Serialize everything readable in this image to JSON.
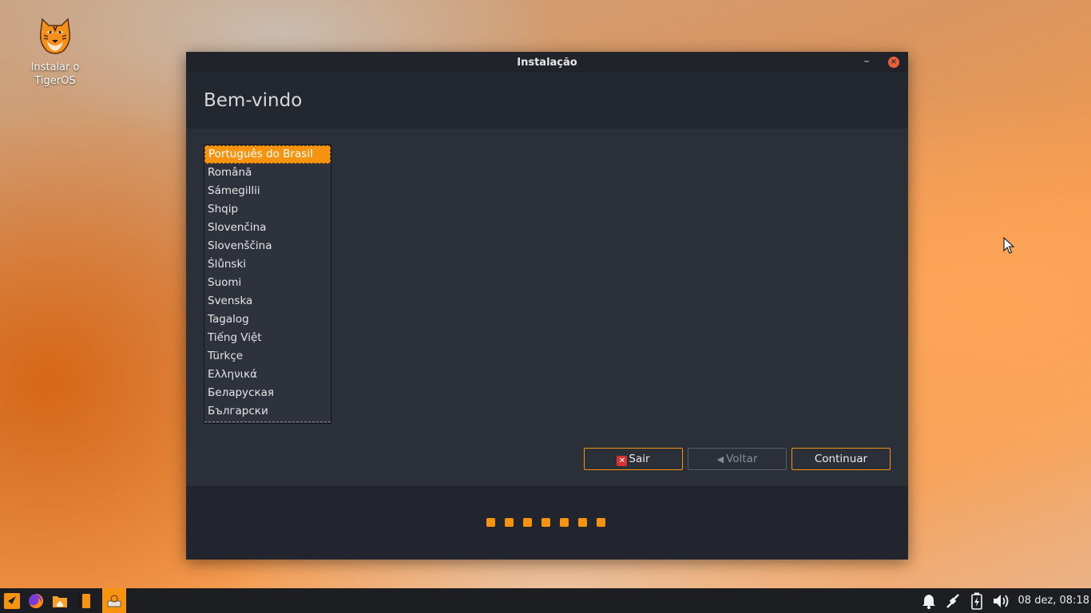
{
  "desktop": {
    "icon_label": "Instalar o TigerOS"
  },
  "window": {
    "title": "Instalação",
    "minimize_glyph": "–",
    "close_glyph": "×",
    "heading": "Bem-vindo"
  },
  "languages": {
    "selected": "Português do Brasil",
    "items": [
      "Português do Brasil",
      "Română",
      "Sámegillii",
      "Shqip",
      "Slovenčina",
      "Slovenščina",
      "Ślůnski",
      "Suomi",
      "Svenska",
      "Tagalog",
      "Tiếng Việt",
      "Türkçe",
      "Ελληνικά",
      "Беларуская",
      "Български"
    ]
  },
  "buttons": {
    "quit": "Sair",
    "back": "Voltar",
    "continue": "Continuar"
  },
  "progress": {
    "step_count": 7
  },
  "taskbar": {
    "clock": "08 dez, 08:18"
  },
  "colors": {
    "accent": "#f7940f",
    "window_bg": "#2b2f38",
    "close_button": "#e8613c"
  }
}
